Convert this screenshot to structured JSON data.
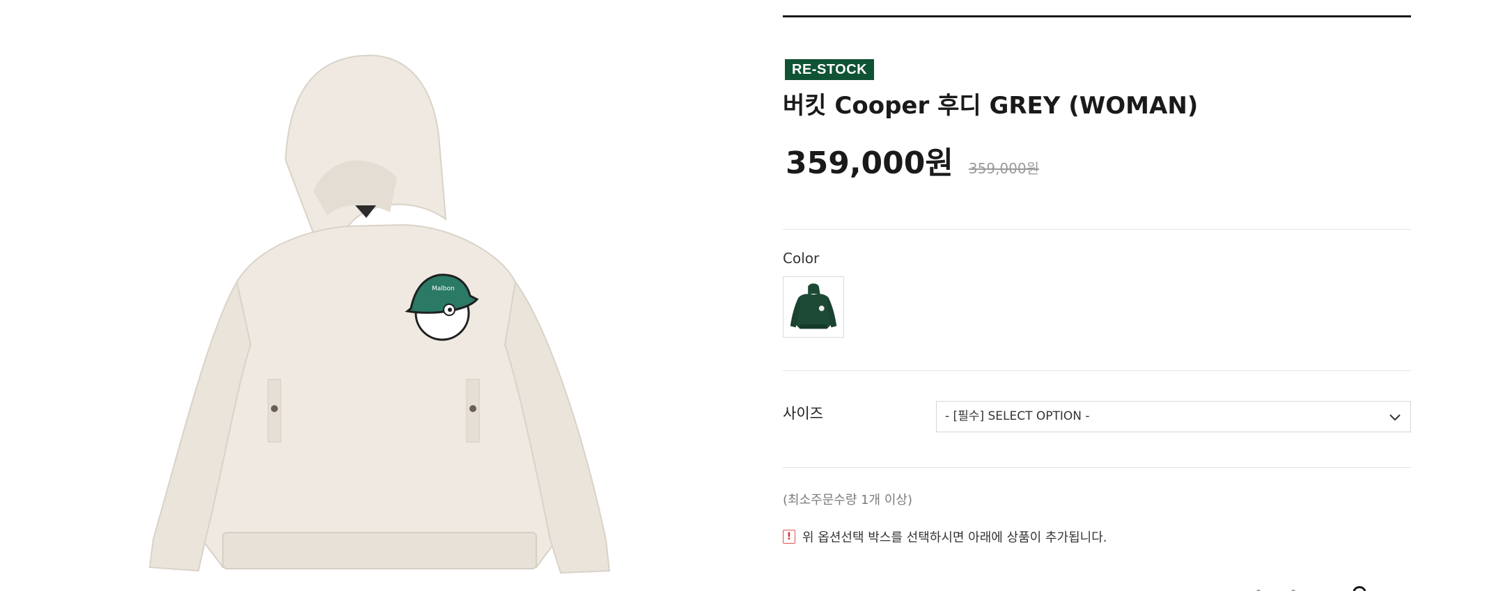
{
  "product": {
    "badge": "RE-STOCK",
    "title": "버킷 Cooper 후디 GREY (WOMAN)",
    "price": "359,000원",
    "original_price": "359,000원"
  },
  "options": {
    "color_label": "Color",
    "color_swatch_icon": "hoodie-thumbnail",
    "size_label": "사이즈",
    "size_select_value": "- [필수] SELECT OPTION -"
  },
  "info": {
    "min_quantity": "(최소주문수량 1개 이상)",
    "notice_icon": "!",
    "notice_text": "위 옵션선택 박스를 선택하시면 아래에 상품이 추가됩니다."
  },
  "colors": {
    "badge_bg": "#0f5234",
    "hoodie": "#efe9e1",
    "swatch_hoodie": "#1d4a35",
    "accent_green": "#2a7a66"
  }
}
